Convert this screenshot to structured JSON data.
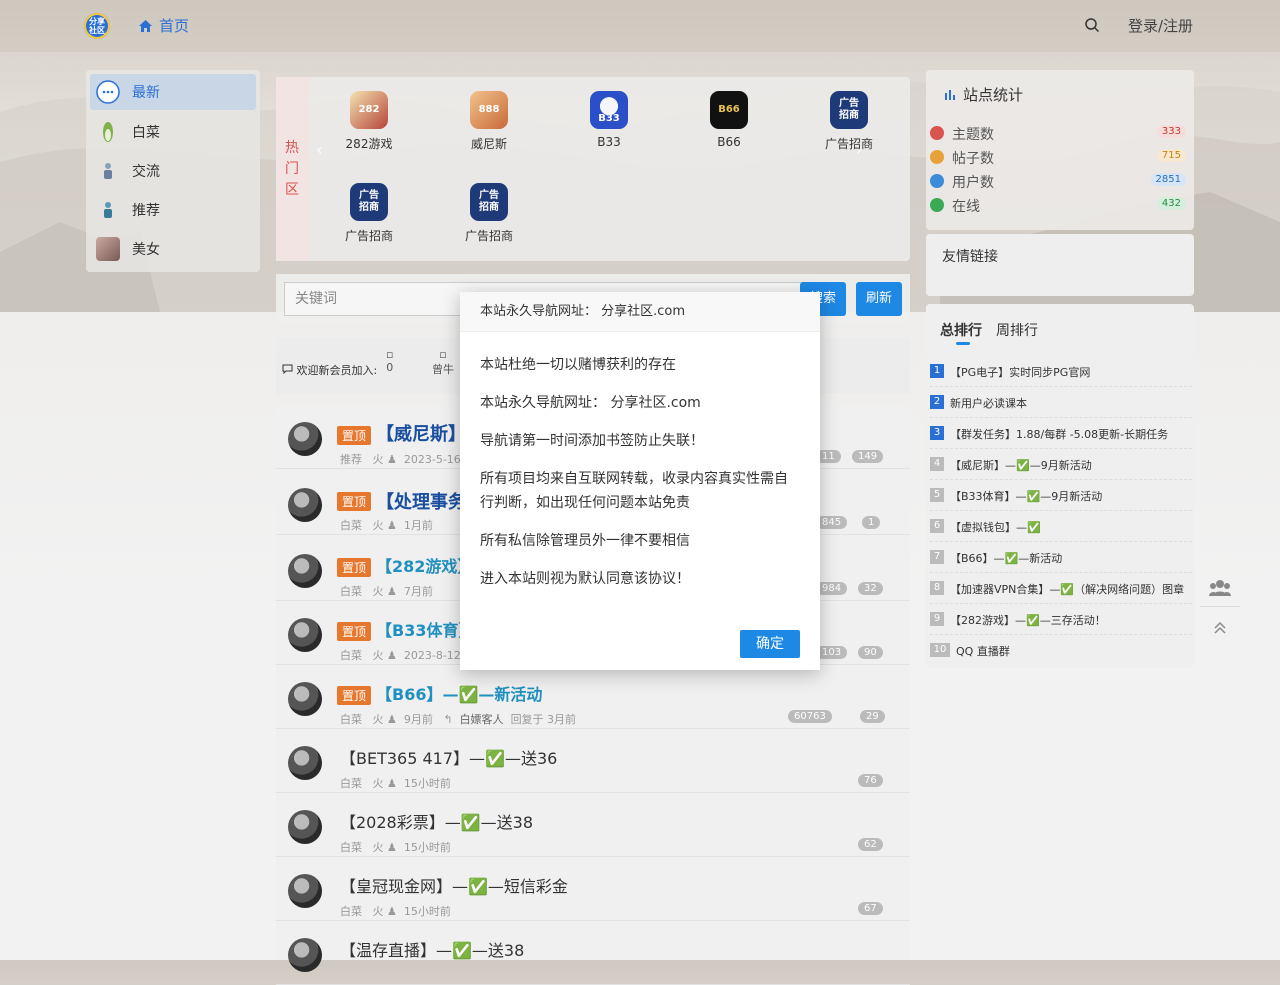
{
  "header": {
    "logo_text": "分享社区",
    "nav_home": "首页",
    "login": "登录/注册"
  },
  "sidebar": {
    "items": [
      {
        "label": "最新",
        "icon": "chat-bubble-icon"
      },
      {
        "label": "白菜",
        "icon": "cabbage-icon"
      },
      {
        "label": "交流",
        "icon": "figure-icon"
      },
      {
        "label": "推荐",
        "icon": "figure-icon"
      },
      {
        "label": "美女",
        "icon": "portrait-icon"
      }
    ]
  },
  "hotzone": {
    "tag": [
      "热",
      "门",
      "区"
    ],
    "apps": [
      {
        "label": "282游戏",
        "icon_text": "282"
      },
      {
        "label": "威尼斯",
        "icon_text": "888"
      },
      {
        "label": "B33",
        "icon_text": "B33"
      },
      {
        "label": "B66",
        "icon_text": "B66"
      },
      {
        "label": "广告招商",
        "icon_text": "广告\n招商"
      },
      {
        "label": "广告招商",
        "icon_text": "广告\n招商"
      },
      {
        "label": "广告招商",
        "icon_text": "广告\n招商"
      }
    ]
  },
  "search": {
    "placeholder": "关键词",
    "search_btn": "搜索",
    "refresh_btn": "刷新"
  },
  "welcome": {
    "label": "欢迎新会员加入:",
    "members": [
      "0",
      "曾牛"
    ]
  },
  "posts": [
    {
      "pin": "置顶",
      "title": "【威尼斯】",
      "category": "推荐",
      "author": "火",
      "time": "2023-5-16",
      "views": "11",
      "comments": "149"
    },
    {
      "pin": "置顶",
      "title": "【处理事务",
      "category": "白菜",
      "author": "火",
      "time": "1月前",
      "views": "845",
      "comments": "1"
    },
    {
      "pin": "置顶",
      "title": "【282游戏】",
      "category": "白菜",
      "author": "火",
      "time": "7月前",
      "views": "984",
      "comments": "32"
    },
    {
      "pin": "置顶",
      "title": "【B33体育】",
      "category": "白菜",
      "author": "火",
      "time": "2023-8-12",
      "views": "103",
      "comments": "90"
    },
    {
      "pin": "置顶",
      "title": "【B66】—✅—新活动",
      "category": "白菜",
      "author": "火",
      "time": "9月前",
      "reply_user": "白嫖客人",
      "reply_time": "回复于 3月前",
      "views": "60763",
      "comments": "29"
    },
    {
      "pin": "",
      "title": "【BET365 417】—✅—送36",
      "category": "白菜",
      "author": "火",
      "time": "15小时前",
      "views": "76"
    },
    {
      "pin": "",
      "title": "【2028彩票】—✅—送38",
      "category": "白菜",
      "author": "火",
      "time": "15小时前",
      "views": "62"
    },
    {
      "pin": "",
      "title": "【皇冠现金网】—✅—短信彩金",
      "category": "白菜",
      "author": "火",
      "time": "15小时前",
      "views": "67"
    },
    {
      "pin": "",
      "title": "【温存直播】—✅—送38",
      "category": "",
      "author": "",
      "time": "",
      "views": ""
    }
  ],
  "stats": {
    "title": "站点统计",
    "rows": [
      {
        "label": "主题数",
        "value": "333",
        "color": "#d9534f"
      },
      {
        "label": "帖子数",
        "value": "715",
        "color": "#e8a23a"
      },
      {
        "label": "用户数",
        "value": "2851",
        "color": "#3a8bd9"
      },
      {
        "label": "在线",
        "value": "432",
        "color": "#3aaa55"
      }
    ]
  },
  "links": {
    "title": "友情链接"
  },
  "ranking": {
    "tabs": [
      "总排行",
      "周排行"
    ],
    "items": [
      {
        "num": "1",
        "text": "【PG电子】实时同步PG官网"
      },
      {
        "num": "2",
        "text": "新用户必读课本"
      },
      {
        "num": "3",
        "text": "【群发任务】1.88/每群 -5.08更新-长期任务"
      },
      {
        "num": "4",
        "text": "【威尼斯】—✅—9月新活动"
      },
      {
        "num": "5",
        "text": "【B33体育】—✅—9月新活动"
      },
      {
        "num": "6",
        "text": "【虚拟钱包】—✅"
      },
      {
        "num": "7",
        "text": "【B66】—✅—新活动"
      },
      {
        "num": "8",
        "text": "【加速器VPN合集】—✅（解决网络问题）图章"
      },
      {
        "num": "9",
        "text": "【282游戏】—✅—三存活动！"
      },
      {
        "num": "10",
        "text": "QQ 直播群"
      }
    ]
  },
  "modal": {
    "title": "本站永久导航网址： 分享社区.com",
    "lines": [
      "本站杜绝一切以赌博获利的存在",
      "本站永久导航网址： 分享社区.com",
      "导航请第一时间添加书签防止失联！",
      "所有项目均来自互联网转载，收录内容真实性需自行判断，如出现任何问题本站免责",
      "所有私信除管理员外一律不要相信",
      "进入本站则视为默认同意该协议！"
    ],
    "confirm": "确定"
  }
}
